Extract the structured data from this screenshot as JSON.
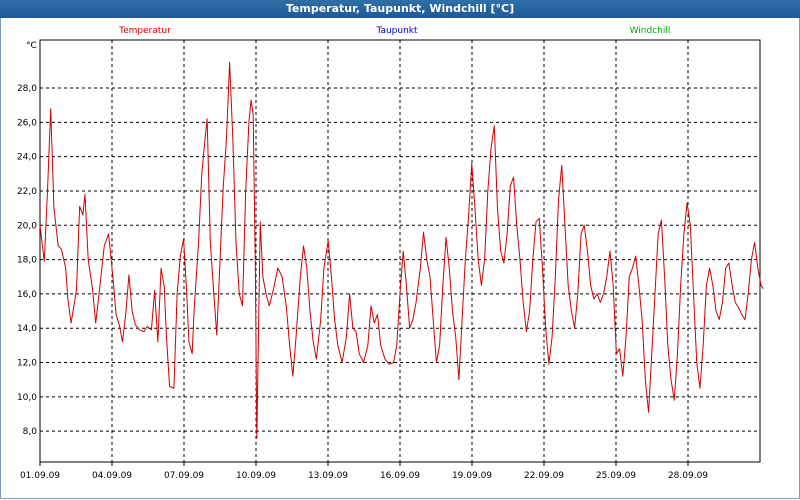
{
  "window": {
    "title": "Temperatur, Taupunkt, Windchill [°C]"
  },
  "chart_data": {
    "type": "line",
    "title": "Temperatur, Taupunkt, Windchill [°C]",
    "ylabel": "°C",
    "ylim": [
      6.2,
      30.8
    ],
    "yticks": [
      "8,0",
      "10,0",
      "12,0",
      "14,0",
      "16,0",
      "18,0",
      "20,0",
      "22,0",
      "24,0",
      "26,0",
      "28,0"
    ],
    "xlabels": [
      "01.09.09",
      "04.09.09",
      "07.09.09",
      "10.09.09",
      "13.09.09",
      "16.09.09",
      "19.09.09",
      "22.09.09",
      "25.09.09",
      "28.09.09"
    ],
    "xlim_days": [
      0,
      30
    ],
    "grid": true,
    "legend": [
      {
        "name": "Temperatur",
        "color": "#e00000"
      },
      {
        "name": "Taupunkt",
        "color": "#0000cc"
      },
      {
        "name": "Windchill",
        "color": "#00aa00"
      }
    ],
    "series": [
      {
        "name": "Temperatur",
        "color": "#d00000",
        "points": [
          [
            0,
            20.0
          ],
          [
            0.2,
            17.9
          ],
          [
            0.35,
            22.0
          ],
          [
            0.5,
            26.8
          ],
          [
            0.65,
            21.0
          ],
          [
            0.85,
            18.8
          ],
          [
            1.0,
            18.6
          ],
          [
            1.2,
            17.5
          ],
          [
            1.3,
            15.7
          ],
          [
            1.45,
            14.3
          ],
          [
            1.7,
            16.2
          ],
          [
            1.85,
            21.1
          ],
          [
            2.0,
            20.6
          ],
          [
            2.1,
            21.8
          ],
          [
            2.25,
            18.0
          ],
          [
            2.45,
            16.3
          ],
          [
            2.6,
            14.3
          ],
          [
            2.8,
            16.5
          ],
          [
            3.0,
            18.8
          ],
          [
            3.2,
            19.5
          ],
          [
            3.4,
            17.0
          ],
          [
            3.55,
            14.8
          ],
          [
            3.7,
            14.2
          ],
          [
            3.85,
            13.2
          ],
          [
            4.0,
            14.8
          ],
          [
            4.15,
            17.1
          ],
          [
            4.3,
            15.0
          ],
          [
            4.45,
            14.2
          ],
          [
            4.65,
            13.9
          ],
          [
            4.85,
            13.8
          ],
          [
            5.0,
            14.1
          ],
          [
            5.2,
            13.9
          ],
          [
            5.35,
            16.2
          ],
          [
            5.5,
            13.2
          ],
          [
            5.65,
            17.5
          ],
          [
            5.8,
            16.4
          ],
          [
            5.9,
            13.5
          ],
          [
            6.05,
            10.6
          ],
          [
            6.25,
            10.5
          ],
          [
            6.4,
            16.0
          ],
          [
            6.55,
            18.2
          ],
          [
            6.7,
            19.2
          ],
          [
            6.85,
            16.0
          ],
          [
            6.95,
            13.2
          ],
          [
            7.1,
            12.5
          ],
          [
            7.2,
            15.2
          ],
          [
            7.4,
            19.0
          ],
          [
            7.55,
            23.0
          ],
          [
            7.7,
            25.0
          ],
          [
            7.8,
            26.2
          ],
          [
            7.95,
            19.0
          ],
          [
            8.1,
            16.2
          ],
          [
            8.25,
            13.6
          ],
          [
            8.4,
            17.9
          ],
          [
            8.55,
            22.2
          ],
          [
            8.7,
            25.0
          ],
          [
            8.85,
            29.5
          ],
          [
            9.0,
            25.0
          ],
          [
            9.15,
            18.9
          ],
          [
            9.3,
            16.0
          ],
          [
            9.45,
            15.3
          ],
          [
            9.6,
            22.0
          ],
          [
            9.75,
            26.0
          ],
          [
            9.85,
            27.3
          ],
          [
            9.95,
            26.4
          ],
          [
            10.05,
            17.5
          ],
          [
            10.12,
            7.6
          ],
          [
            10.2,
            14.0
          ],
          [
            10.28,
            20.2
          ],
          [
            10.4,
            17.0
          ],
          [
            10.55,
            16.0
          ],
          [
            10.7,
            15.3
          ],
          [
            10.9,
            16.3
          ],
          [
            11.1,
            17.5
          ],
          [
            11.3,
            17.0
          ],
          [
            11.5,
            15.2
          ],
          [
            11.65,
            13.0
          ],
          [
            11.8,
            11.2
          ],
          [
            11.95,
            13.5
          ],
          [
            12.15,
            17.0
          ],
          [
            12.3,
            18.8
          ],
          [
            12.45,
            17.5
          ],
          [
            12.6,
            15.0
          ],
          [
            12.75,
            13.2
          ],
          [
            12.9,
            12.2
          ],
          [
            13.1,
            14.5
          ],
          [
            13.25,
            17.5
          ],
          [
            13.45,
            19.1
          ],
          [
            13.6,
            17.0
          ],
          [
            13.75,
            14.5
          ],
          [
            13.9,
            13.0
          ],
          [
            14.1,
            12.0
          ],
          [
            14.3,
            13.5
          ],
          [
            14.45,
            16.0
          ],
          [
            14.6,
            14.0
          ],
          [
            14.75,
            13.8
          ],
          [
            14.9,
            12.5
          ],
          [
            15.1,
            12.0
          ],
          [
            15.3,
            13.0
          ],
          [
            15.45,
            15.3
          ],
          [
            15.6,
            14.3
          ],
          [
            15.75,
            14.8
          ],
          [
            15.9,
            13.0
          ],
          [
            16.1,
            12.2
          ],
          [
            16.3,
            11.9
          ],
          [
            16.5,
            12.0
          ],
          [
            16.65,
            13.0
          ],
          [
            16.8,
            16.0
          ],
          [
            16.95,
            18.5
          ],
          [
            17.1,
            16.5
          ],
          [
            17.25,
            14.0
          ],
          [
            17.4,
            14.5
          ],
          [
            17.55,
            15.5
          ],
          [
            17.75,
            17.5
          ],
          [
            17.9,
            19.6
          ],
          [
            18.05,
            18.0
          ],
          [
            18.2,
            17.0
          ],
          [
            18.35,
            14.5
          ],
          [
            18.5,
            12.0
          ],
          [
            18.65,
            13.0
          ],
          [
            18.8,
            16.5
          ],
          [
            18.95,
            19.3
          ],
          [
            19.1,
            17.5
          ],
          [
            19.25,
            15.0
          ],
          [
            19.4,
            13.5
          ],
          [
            19.55,
            11.0
          ],
          [
            19.7,
            14.5
          ],
          [
            19.85,
            18.0
          ],
          [
            20.0,
            20.5
          ],
          [
            20.15,
            23.6
          ],
          [
            20.3,
            21.0
          ],
          [
            20.45,
            18.0
          ],
          [
            20.6,
            16.5
          ],
          [
            20.75,
            18.0
          ],
          [
            20.9,
            22.0
          ],
          [
            21.05,
            24.5
          ],
          [
            21.2,
            25.8
          ],
          [
            21.35,
            21.0
          ],
          [
            21.5,
            18.5
          ],
          [
            21.65,
            17.8
          ],
          [
            21.8,
            19.5
          ],
          [
            21.95,
            22.3
          ],
          [
            22.1,
            22.8
          ],
          [
            22.25,
            20.0
          ],
          [
            22.4,
            18.0
          ],
          [
            22.55,
            15.5
          ],
          [
            22.7,
            13.8
          ],
          [
            22.85,
            15.0
          ],
          [
            23.0,
            18.0
          ],
          [
            23.15,
            20.2
          ],
          [
            23.3,
            20.4
          ],
          [
            23.45,
            17.5
          ],
          [
            23.6,
            14.0
          ],
          [
            23.75,
            11.9
          ],
          [
            23.9,
            13.5
          ],
          [
            24.05,
            17.0
          ],
          [
            24.2,
            21.5
          ],
          [
            24.35,
            23.5
          ],
          [
            24.5,
            20.0
          ],
          [
            24.65,
            16.5
          ],
          [
            24.8,
            15.0
          ],
          [
            24.95,
            14.0
          ],
          [
            25.1,
            16.0
          ],
          [
            25.25,
            19.5
          ],
          [
            25.4,
            20.0
          ],
          [
            25.55,
            18.5
          ],
          [
            25.7,
            16.5
          ],
          [
            25.85,
            15.7
          ],
          [
            26.0,
            16.0
          ],
          [
            26.15,
            15.5
          ],
          [
            26.3,
            16.0
          ],
          [
            26.45,
            17.0
          ],
          [
            26.6,
            18.5
          ],
          [
            26.75,
            16.5
          ],
          [
            26.9,
            12.5
          ],
          [
            27.05,
            12.8
          ],
          [
            27.2,
            11.2
          ],
          [
            27.35,
            13.5
          ],
          [
            27.5,
            17.0
          ],
          [
            27.65,
            17.5
          ],
          [
            27.8,
            18.2
          ],
          [
            27.95,
            16.5
          ],
          [
            28.1,
            14.5
          ],
          [
            28.25,
            11.0
          ],
          [
            28.4,
            9.1
          ],
          [
            28.55,
            12.5
          ],
          [
            28.7,
            16.0
          ],
          [
            28.85,
            19.5
          ],
          [
            29.0,
            20.3
          ],
          [
            29.15,
            17.0
          ],
          [
            29.3,
            13.0
          ],
          [
            29.45,
            11.0
          ],
          [
            29.6,
            9.8
          ],
          [
            29.75,
            12.5
          ],
          [
            29.9,
            16.5
          ],
          [
            30.05,
            19.5
          ],
          [
            30.2,
            21.3
          ],
          [
            30.35,
            20.0
          ],
          [
            30.5,
            16.0
          ],
          [
            30.65,
            12.0
          ],
          [
            30.8,
            10.5
          ],
          [
            30.95,
            13.0
          ],
          [
            31.1,
            16.5
          ],
          [
            31.25,
            17.5
          ],
          [
            31.4,
            16.5
          ],
          [
            31.55,
            15.0
          ],
          [
            31.7,
            14.5
          ],
          [
            31.85,
            15.5
          ],
          [
            32.0,
            17.5
          ],
          [
            32.15,
            17.8
          ],
          [
            32.3,
            16.5
          ],
          [
            32.45,
            15.5
          ],
          [
            32.6,
            15.2
          ],
          [
            32.75,
            14.8
          ],
          [
            32.9,
            14.5
          ],
          [
            33.05,
            16.0
          ],
          [
            33.2,
            18.0
          ],
          [
            33.35,
            19.0
          ],
          [
            33.5,
            17.5
          ],
          [
            33.65,
            16.5
          ],
          [
            33.75,
            16.3
          ]
        ]
      }
    ]
  }
}
